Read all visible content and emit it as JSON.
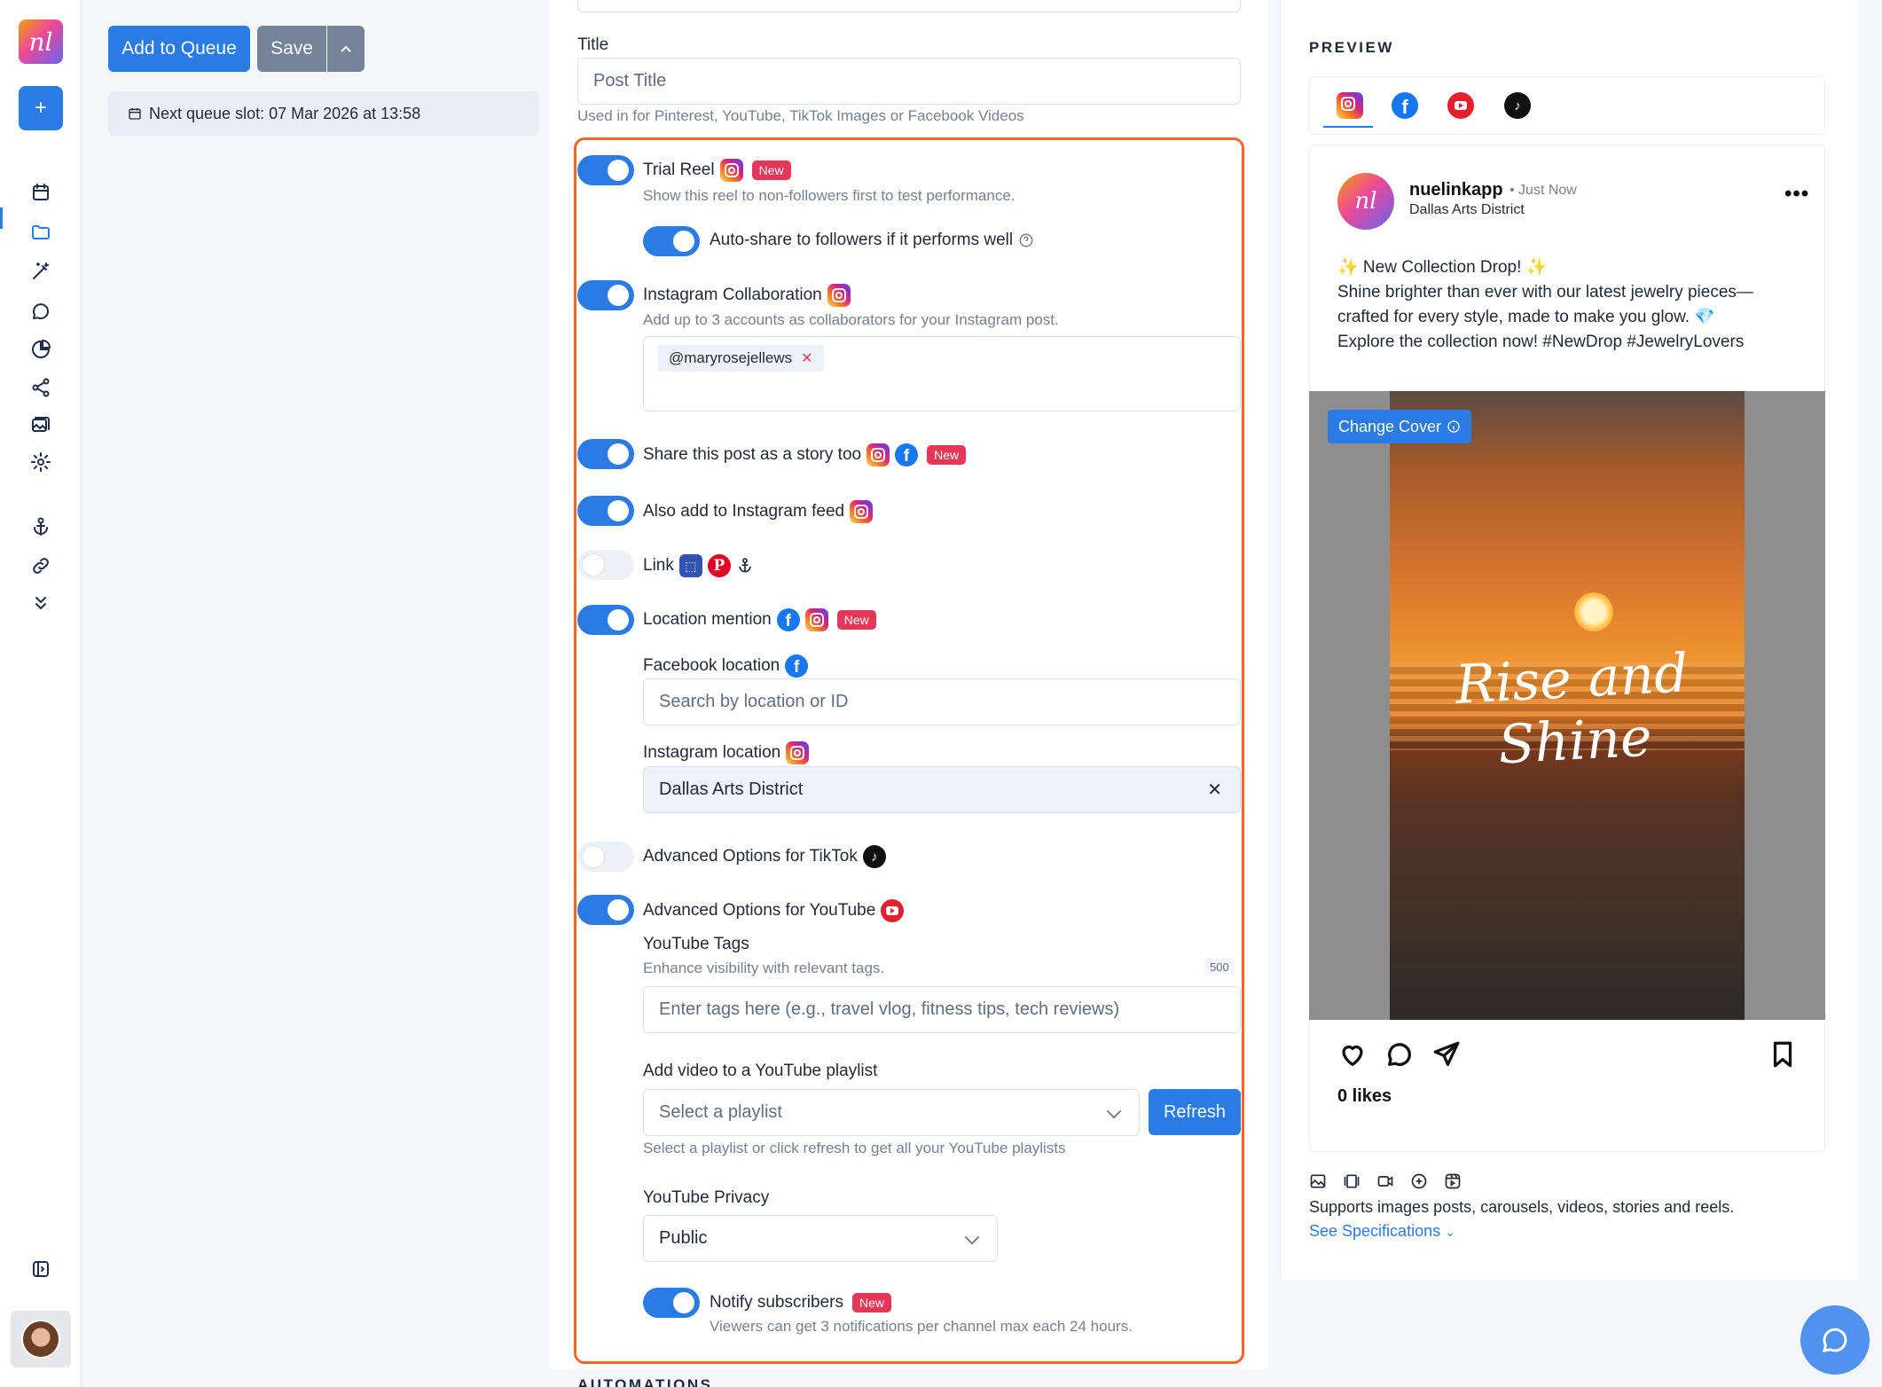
{
  "app": {
    "logo": "nl"
  },
  "sidebar": {
    "icons": [
      "calendar-icon",
      "folder-icon",
      "magic-wand-icon",
      "chat-icon",
      "pie-chart-icon",
      "share-icon",
      "gallery-icon",
      "gear-icon",
      "anchor-icon",
      "link-icon",
      "chevrons-down-icon",
      "sidebar-toggle-icon"
    ]
  },
  "toolbar": {
    "add_to_queue": "Add to Queue",
    "save": "Save",
    "next_queue_slot": "Next queue slot: 07 Mar 2026 at 13:58"
  },
  "form": {
    "title_label": "Title",
    "title_placeholder": "Post Title",
    "title_hint": "Used in for Pinterest, YouTube, TikTok Images or Facebook Videos",
    "trial_reel": {
      "label": "Trial Reel",
      "badge": "New",
      "desc": "Show this reel to non-followers first to test performance.",
      "on": true
    },
    "auto_share": {
      "label": "Auto-share to followers if it performs well",
      "on": true
    },
    "collab": {
      "label": "Instagram Collaboration",
      "desc": "Add up to 3 accounts as collaborators for your Instagram post.",
      "chip": "@maryrosejellews",
      "on": true
    },
    "story": {
      "label": "Share this post as a story too",
      "badge": "New",
      "on": true
    },
    "feed": {
      "label": "Also add to Instagram feed",
      "on": true
    },
    "link": {
      "label": "Link",
      "on": false
    },
    "location": {
      "label": "Location mention",
      "badge": "New",
      "on": true
    },
    "facebook_location": {
      "label": "Facebook location",
      "placeholder": "Search by location or ID"
    },
    "instagram_location": {
      "label": "Instagram location",
      "value": "Dallas Arts District"
    },
    "tiktok": {
      "label": "Advanced Options for TikTok",
      "on": false
    },
    "youtube": {
      "label": "Advanced Options for YouTube",
      "on": true
    },
    "yt_tags": {
      "label": "YouTube Tags",
      "desc": "Enhance visibility with relevant tags.",
      "counter": "500",
      "placeholder": "Enter tags here (e.g., travel vlog, fitness tips, tech reviews)"
    },
    "playlist": {
      "label": "Add video to a YouTube playlist",
      "placeholder": "Select a playlist",
      "refresh": "Refresh",
      "hint": "Select a playlist or click refresh to get all your YouTube playlists"
    },
    "privacy": {
      "label": "YouTube Privacy",
      "value": "Public"
    },
    "notify": {
      "label": "Notify subscribers",
      "badge": "New",
      "desc": "Viewers can get 3 notifications per channel max each 24 hours.",
      "on": true
    },
    "automations_heading": "AUTOMATIONS"
  },
  "preview": {
    "title": "PREVIEW",
    "tabs": [
      "instagram",
      "facebook",
      "youtube",
      "tiktok"
    ],
    "active_tab": "instagram",
    "post": {
      "username": "nuelinkapp",
      "time": "• Just Now",
      "location": "Dallas Arts District",
      "caption_lines": [
        "✨ New Collection Drop! ✨",
        "Shine brighter than ever with our latest jewelry pieces—",
        "crafted for every style, made to make you glow. 💎",
        "Explore the collection now! #NewDrop #JewelryLovers"
      ],
      "change_cover": "Change Cover",
      "overlay_text": "Rise and Shine",
      "likes": "0 likes"
    },
    "supports": "Supports images posts, carousels, videos, stories and reels.",
    "see_specs": "See Specifications"
  },
  "colors": {
    "accent": "#2a7be4",
    "highlight": "#f5642b",
    "badge": "#e63757"
  }
}
